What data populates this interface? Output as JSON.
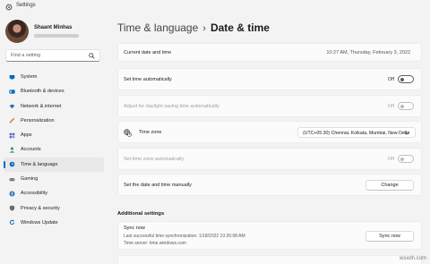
{
  "window": {
    "title": "Settings"
  },
  "profile": {
    "name": "Shaant Minhas"
  },
  "search": {
    "placeholder": "Find a setting"
  },
  "sidebar": {
    "items": [
      {
        "label": "System",
        "icon": "monitor-icon",
        "color": "#0067c0"
      },
      {
        "label": "Bluetooth & devices",
        "icon": "bluetooth-icon",
        "color": "#0067c0"
      },
      {
        "label": "Network & internet",
        "icon": "wifi-icon",
        "color": "#2a6bb5"
      },
      {
        "label": "Personalization",
        "icon": "brush-icon",
        "color": "#d17b2e"
      },
      {
        "label": "Apps",
        "icon": "apps-icon",
        "color": "#5b5fc7"
      },
      {
        "label": "Accounts",
        "icon": "person-icon",
        "color": "#2e9a68"
      },
      {
        "label": "Time & language",
        "icon": "clock-globe-icon",
        "color": "#0067c0",
        "selected": true
      },
      {
        "label": "Gaming",
        "icon": "controller-icon",
        "color": "#666666"
      },
      {
        "label": "Accessibility",
        "icon": "accessibility-icon",
        "color": "#2f6fba"
      },
      {
        "label": "Privacy & security",
        "icon": "shield-icon",
        "color": "#6b6b6b"
      },
      {
        "label": "Windows Update",
        "icon": "refresh-icon",
        "color": "#0067c0"
      }
    ]
  },
  "breadcrumb": {
    "parent": "Time & language",
    "separator": "›",
    "current": "Date & time"
  },
  "settings": {
    "current_datetime": {
      "label": "Current date and time",
      "value": "10:27 AM, Thursday, February 3, 2022"
    },
    "set_time_auto": {
      "label": "Set time automatically",
      "state": "Off"
    },
    "daylight": {
      "label": "Adjust for daylight saving time automatically",
      "state": "Off"
    },
    "timezone": {
      "label": "Time zone",
      "value": "(UTC+05:30) Chennai, Kolkata, Mumbai, New Delhi"
    },
    "tz_auto": {
      "label": "Set time zone automatically",
      "state": "Off"
    },
    "manual": {
      "label": "Set the date and time manually",
      "button": "Change"
    }
  },
  "additional": {
    "title": "Additional settings",
    "sync": {
      "title": "Sync now",
      "last_sync": "Last successful time synchronization: 1/18/2022 10:26:08 AM",
      "server": "Time server: time.windows.com",
      "button": "Sync now"
    }
  },
  "watermark": "wsxdn.com"
}
